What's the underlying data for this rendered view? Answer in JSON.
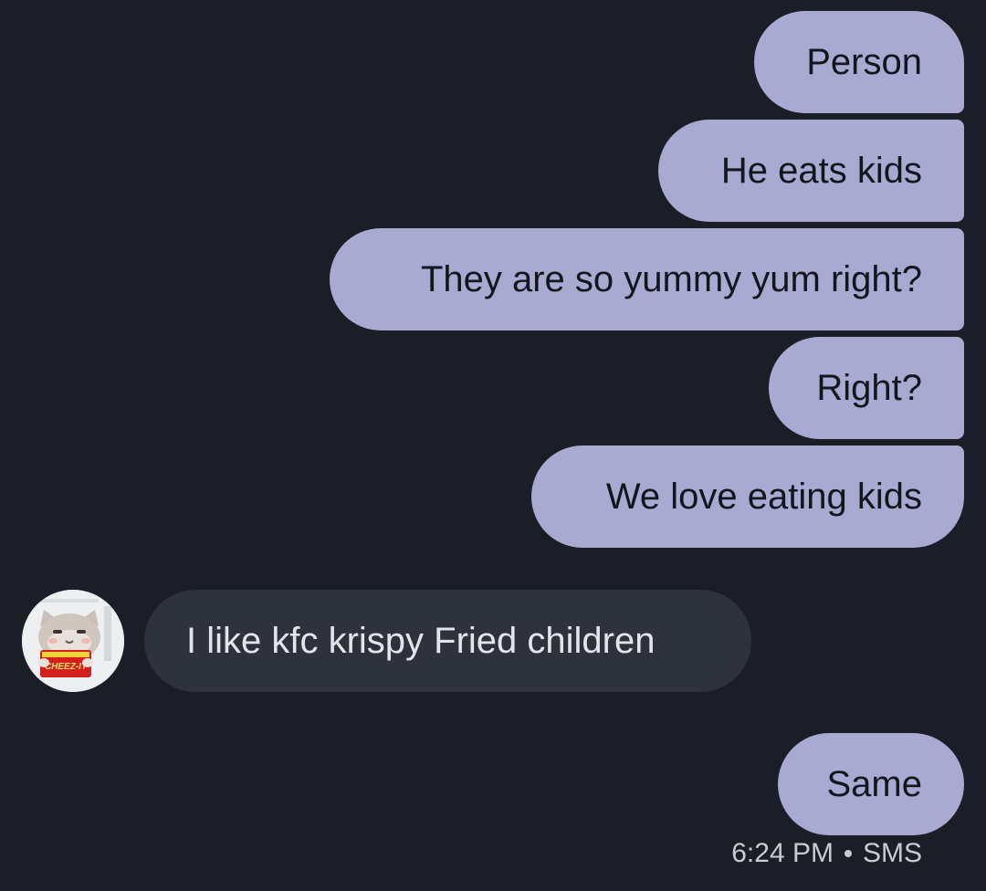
{
  "conversation": {
    "outgoing_top": [
      {
        "text": "Person"
      },
      {
        "text": "He eats kids"
      },
      {
        "text": "They are so yummy yum right?"
      },
      {
        "text": "Right?"
      },
      {
        "text": "We love eating kids"
      }
    ],
    "incoming": {
      "text": "I like kfc krispy Fried children",
      "avatar_icon": "cat-with-cheezit-avatar",
      "avatar_text": "CHEEZ-IT"
    },
    "outgoing_last": {
      "text": "Same"
    },
    "meta": {
      "time": "6:24 PM",
      "channel": "SMS"
    }
  },
  "colors": {
    "background": "#1b1e26",
    "outgoing_bubble": "#a8aad2",
    "incoming_bubble": "#2e323c"
  }
}
